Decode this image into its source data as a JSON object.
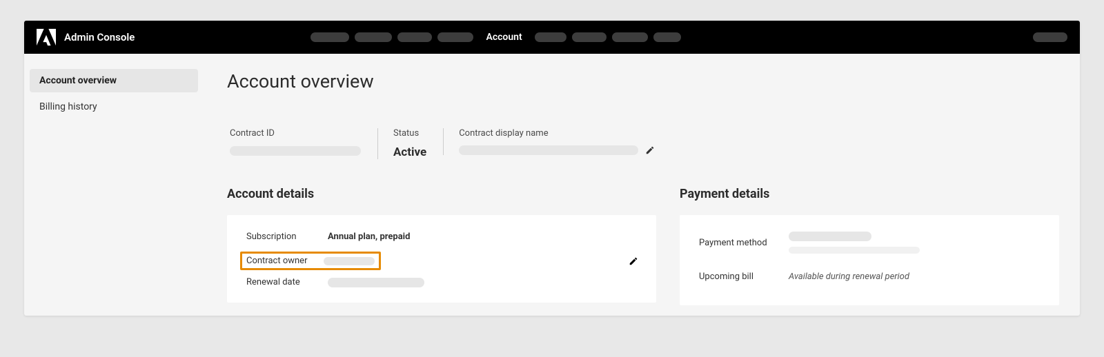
{
  "header": {
    "app_title": "Admin Console",
    "active_nav": "Account"
  },
  "sidebar": {
    "items": [
      {
        "label": "Account overview",
        "active": true
      },
      {
        "label": "Billing history",
        "active": false
      }
    ]
  },
  "main": {
    "page_title": "Account overview",
    "contract": {
      "id_label": "Contract ID",
      "status_label": "Status",
      "status_value": "Active",
      "display_name_label": "Contract display name"
    },
    "account_details": {
      "title": "Account details",
      "subscription_label": "Subscription",
      "subscription_value": "Annual plan, prepaid",
      "contract_owner_label": "Contract owner",
      "renewal_date_label": "Renewal date"
    },
    "payment_details": {
      "title": "Payment details",
      "method_label": "Payment method",
      "upcoming_label": "Upcoming bill",
      "upcoming_value": "Available during renewal period"
    }
  }
}
